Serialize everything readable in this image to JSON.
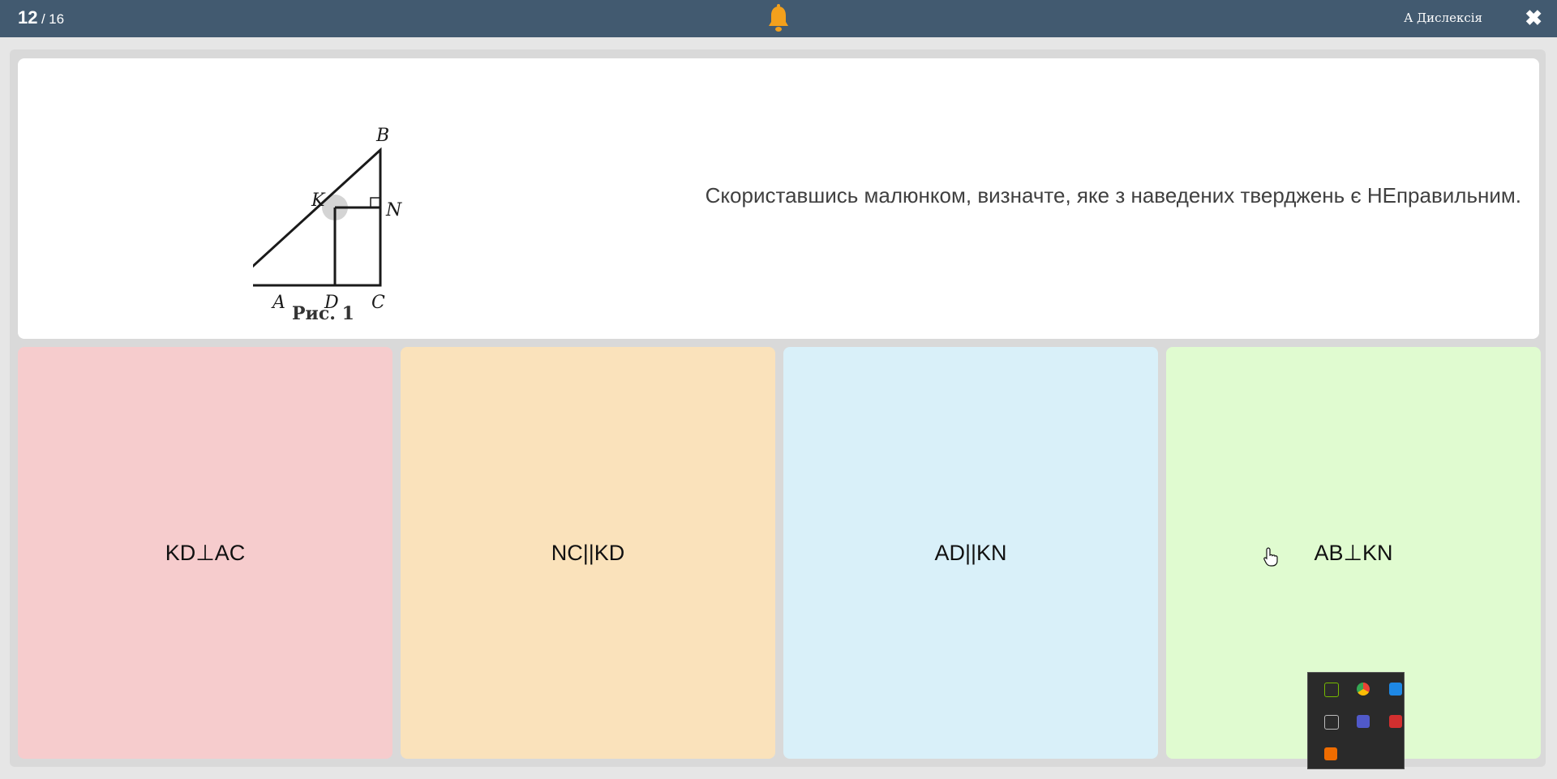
{
  "header": {
    "current": "12",
    "separator": "/",
    "total": "16",
    "dyslexia_label": "A Дислексія",
    "close_glyph": "✖",
    "bell_color": "#f3a01c"
  },
  "question": {
    "text": "Скориставшись малюнком, визначте, яке з наведених тверджень є НЕправильним.",
    "figure": {
      "labels": {
        "A": "A",
        "B": "B",
        "C": "C",
        "D": "D",
        "K": "K",
        "N": "N"
      },
      "caption": "Рис. 1"
    }
  },
  "answers": [
    {
      "label": "KD⊥AC",
      "color": "#f6cccd"
    },
    {
      "label": "NC||KD",
      "color": "#fae2bb"
    },
    {
      "label": "AD||KN",
      "color": "#d9f0f9"
    },
    {
      "label": "AB⊥KN",
      "color": "#e0fbd0"
    }
  ],
  "tray": {
    "icons": [
      "nvidia-icon",
      "chrome-icon",
      "defender-icon",
      "cloud-off-icon",
      "teams-icon",
      "camera-icon",
      "app-icon"
    ]
  }
}
